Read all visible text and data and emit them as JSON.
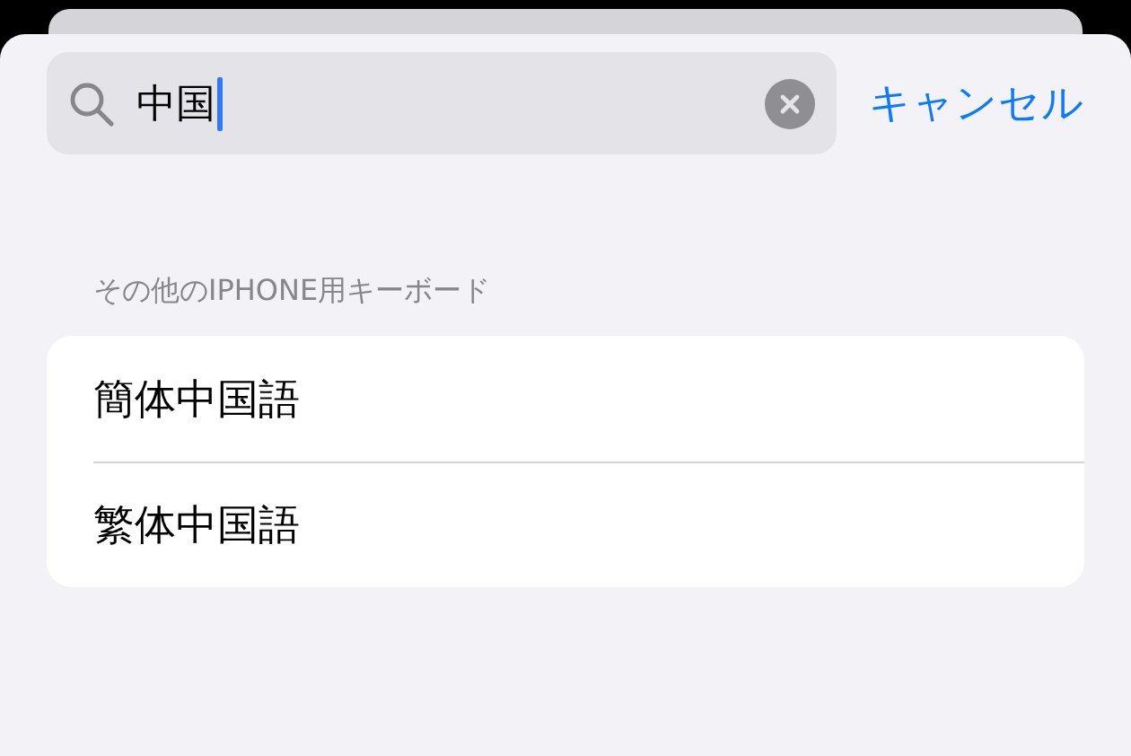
{
  "search": {
    "value": "中国",
    "focused": true
  },
  "cancel_button": "キャンセル",
  "section": {
    "header": "その他のIPHONE用キーボード",
    "rows": [
      {
        "label": "簡体中国語"
      },
      {
        "label": "繁体中国語"
      }
    ]
  }
}
